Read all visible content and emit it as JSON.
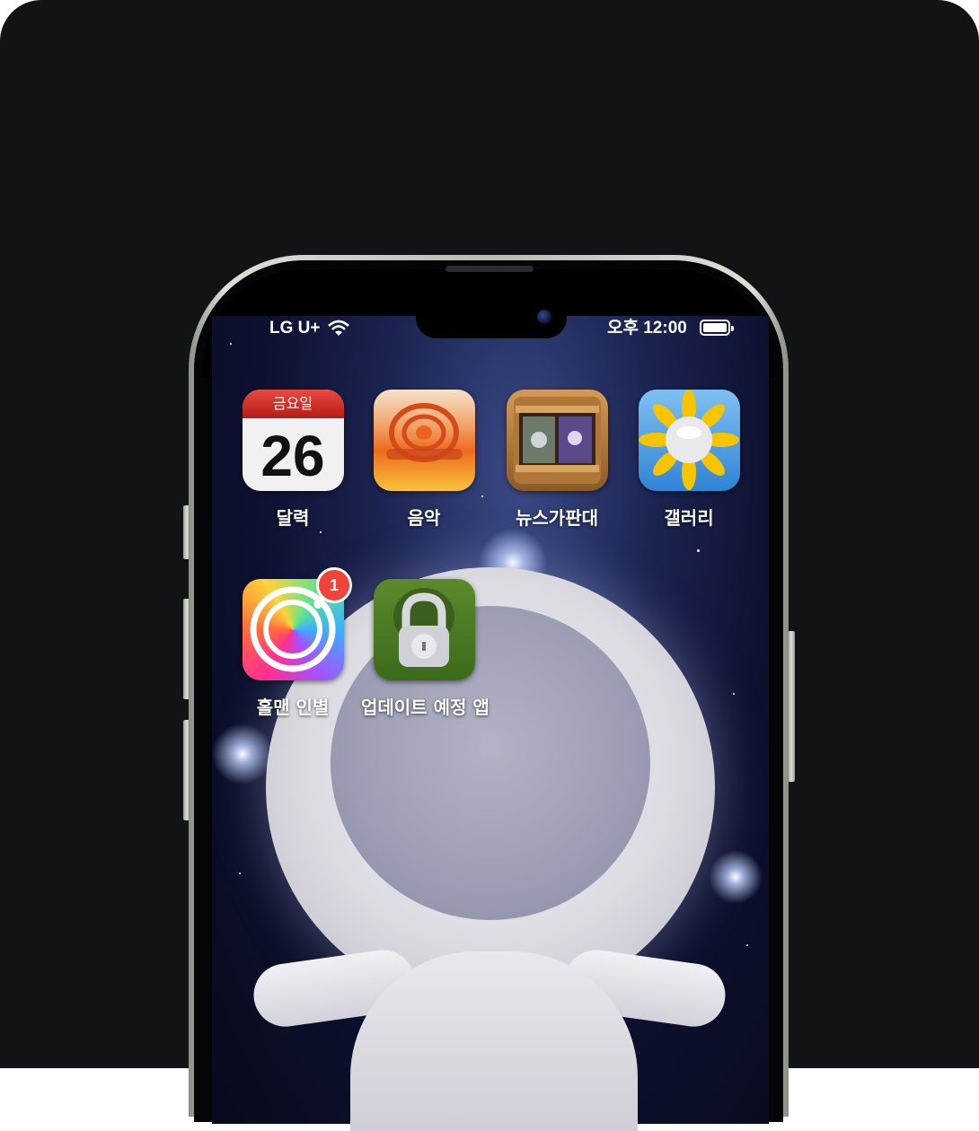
{
  "status_bar": {
    "carrier": "LG U+",
    "time": "오후 12:00",
    "wifi_icon": "wifi-icon",
    "battery_icon": "battery-icon"
  },
  "apps": [
    {
      "name": "calendar",
      "label": "달력",
      "day_name": "금요일",
      "date": "26"
    },
    {
      "name": "music",
      "label": "음악"
    },
    {
      "name": "newsstand",
      "label": "뉴스가판대"
    },
    {
      "name": "gallery",
      "label": "갤러리"
    },
    {
      "name": "camera",
      "label": "홀맨 인별",
      "badge": "1"
    },
    {
      "name": "locked-app",
      "label": "업데이트 예정 앱"
    }
  ]
}
